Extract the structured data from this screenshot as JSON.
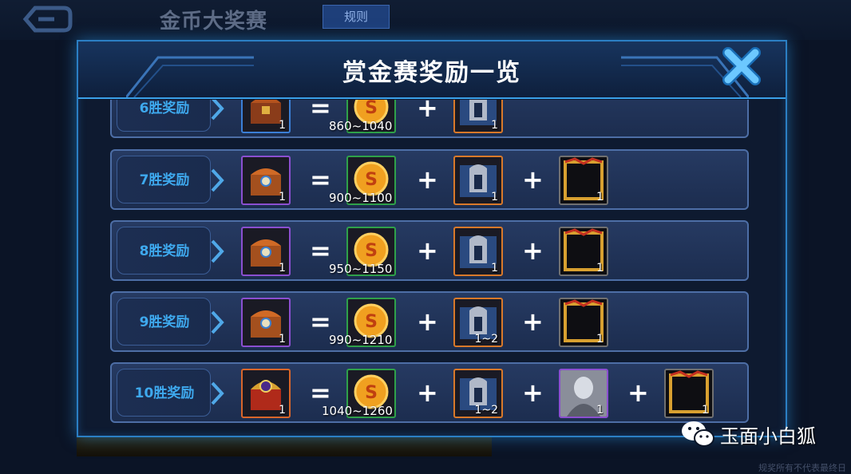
{
  "background": {
    "title": "金币大奖赛",
    "rules_label": "规则",
    "footnote": "规奖所有不代表最终日"
  },
  "modal": {
    "title": "赏金赛奖励一览"
  },
  "rows": [
    {
      "label": "6胜奖励",
      "chest_count": "1",
      "coin_range": "860~1040",
      "helmet_count": "1"
    },
    {
      "label": "7胜奖励",
      "chest_count": "1",
      "coin_range": "900~1100",
      "helmet_count": "1",
      "frame_count": "1"
    },
    {
      "label": "8胜奖励",
      "chest_count": "1",
      "coin_range": "950~1150",
      "helmet_count": "1",
      "frame_count": "1"
    },
    {
      "label": "9胜奖励",
      "chest_count": "1",
      "coin_range": "990~1210",
      "helmet_count": "1~2",
      "frame_count": "1"
    },
    {
      "label": "10胜奖励",
      "chest_count": "1",
      "coin_range": "1040~1260",
      "helmet_count": "1~2",
      "skin_count": "1",
      "frame_count": "1"
    }
  ],
  "operators": {
    "equals": "=",
    "plus": "+"
  },
  "watermark": {
    "text": "玉面小白狐",
    "icon": "wechat-icon"
  },
  "colors": {
    "accent": "#2b7fc4",
    "label_blue": "#3ea9ee",
    "panel": "#1c2d4f"
  }
}
